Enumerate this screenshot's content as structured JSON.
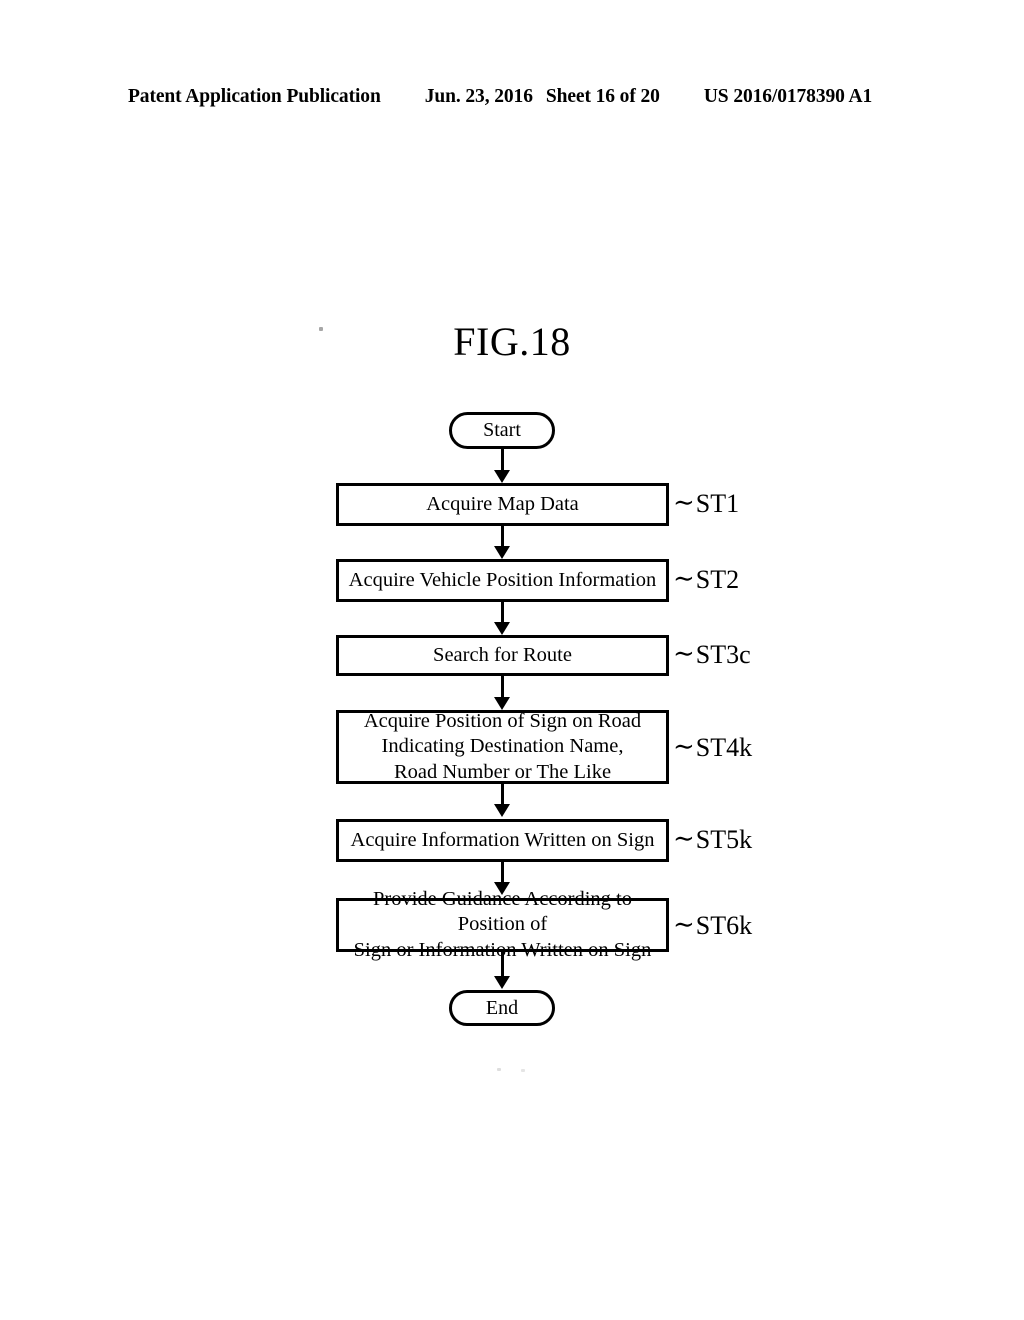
{
  "header": {
    "publication": "Patent Application Publication",
    "date": "Jun. 23, 2016",
    "sheet": "Sheet 16 of 20",
    "patent_number": "US 2016/0178390 A1"
  },
  "figure": {
    "title": "FIG.18"
  },
  "flowchart": {
    "start": {
      "label": "Start"
    },
    "end": {
      "label": "End"
    },
    "steps": [
      {
        "text": "Acquire Map Data",
        "ref": "ST1"
      },
      {
        "text": "Acquire Vehicle Position Information",
        "ref": "ST2"
      },
      {
        "text": "Search for Route",
        "ref": "ST3c"
      },
      {
        "line1": "Acquire Position of Sign on Road",
        "line2": "Indicating Destination Name,",
        "line3": "Road Number or The Like",
        "ref": "ST4k"
      },
      {
        "text": "Acquire Information Written on Sign",
        "ref": "ST5k"
      },
      {
        "line1": "Provide Guidance According to Position of",
        "line2": "Sign or Information Written on Sign",
        "ref": "ST6k"
      }
    ],
    "tilde": "∼"
  },
  "colors": {
    "ink": "#000000",
    "paper": "#ffffff"
  }
}
